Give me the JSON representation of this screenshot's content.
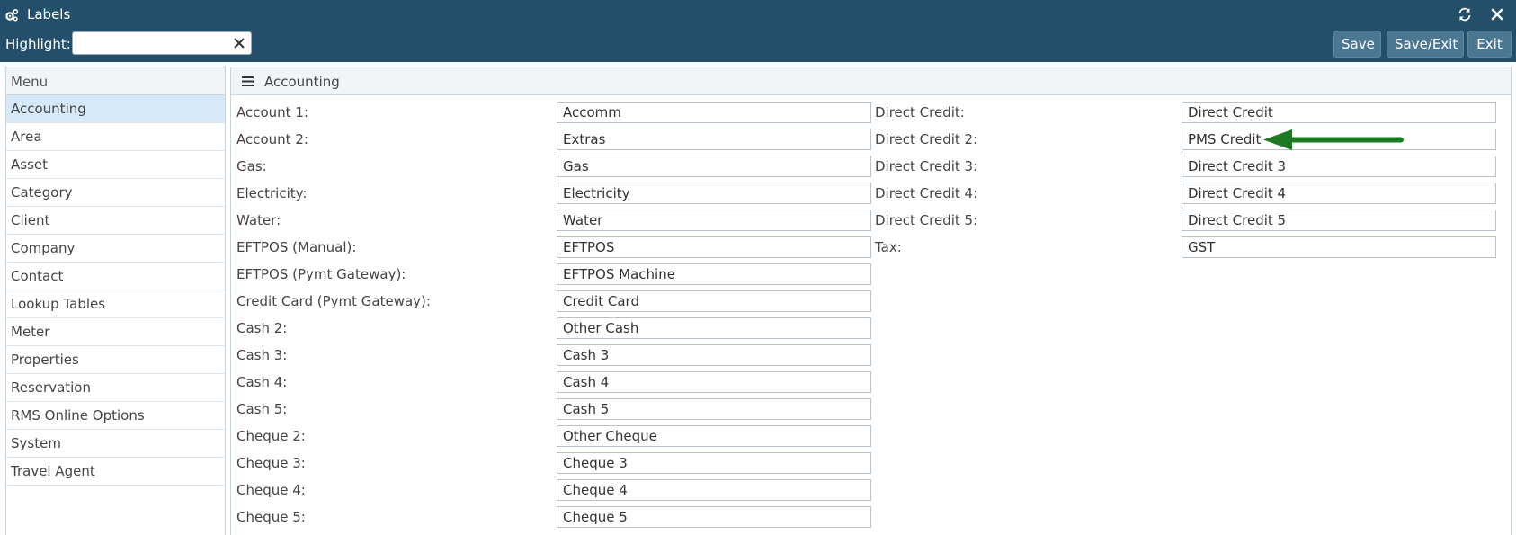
{
  "window": {
    "title": "Labels"
  },
  "toolbar": {
    "highlight_label": "Highlight:",
    "highlight_value": "",
    "save_label": "Save",
    "save_exit_label": "Save/Exit",
    "exit_label": "Exit"
  },
  "sidebar": {
    "heading": "Menu",
    "items": [
      {
        "label": "Accounting"
      },
      {
        "label": "Area"
      },
      {
        "label": "Asset"
      },
      {
        "label": "Category"
      },
      {
        "label": "Client"
      },
      {
        "label": "Company"
      },
      {
        "label": "Contact"
      },
      {
        "label": "Lookup Tables"
      },
      {
        "label": "Meter"
      },
      {
        "label": "Properties"
      },
      {
        "label": "Reservation"
      },
      {
        "label": "RMS Online Options"
      },
      {
        "label": "System"
      },
      {
        "label": "Travel Agent"
      }
    ],
    "active_item": "Accounting"
  },
  "panel": {
    "title": "Accounting",
    "left_fields": [
      {
        "label": "Account 1:",
        "value": "Accomm"
      },
      {
        "label": "Account 2:",
        "value": "Extras"
      },
      {
        "label": "Gas:",
        "value": "Gas"
      },
      {
        "label": "Electricity:",
        "value": "Electricity"
      },
      {
        "label": "Water:",
        "value": "Water"
      },
      {
        "label": "EFTPOS (Manual):",
        "value": "EFTPOS"
      },
      {
        "label": "EFTPOS (Pymt Gateway):",
        "value": "EFTPOS Machine"
      },
      {
        "label": "Credit Card (Pymt Gateway):",
        "value": "Credit Card"
      },
      {
        "label": "Cash 2:",
        "value": "Other Cash"
      },
      {
        "label": "Cash 3:",
        "value": "Cash 3"
      },
      {
        "label": "Cash 4:",
        "value": "Cash 4"
      },
      {
        "label": "Cash 5:",
        "value": "Cash 5"
      },
      {
        "label": "Cheque 2:",
        "value": "Other Cheque"
      },
      {
        "label": "Cheque 3:",
        "value": "Cheque 3"
      },
      {
        "label": "Cheque 4:",
        "value": "Cheque 4"
      },
      {
        "label": "Cheque 5:",
        "value": "Cheque 5"
      }
    ],
    "right_fields": [
      {
        "label": "Direct Credit:",
        "value": "Direct Credit"
      },
      {
        "label": "Direct Credit 2:",
        "value": "PMS Credit"
      },
      {
        "label": "Direct Credit 3:",
        "value": "Direct Credit 3"
      },
      {
        "label": "Direct Credit 4:",
        "value": "Direct Credit 4"
      },
      {
        "label": "Direct Credit 5:",
        "value": "Direct Credit 5"
      },
      {
        "label": "Tax:",
        "value": "GST"
      }
    ]
  },
  "colors": {
    "header_bg": "#234f6b",
    "button_bg": "#4c7791",
    "active_menu_bg": "#d6e9f8",
    "arrow": "#1e7a22"
  }
}
